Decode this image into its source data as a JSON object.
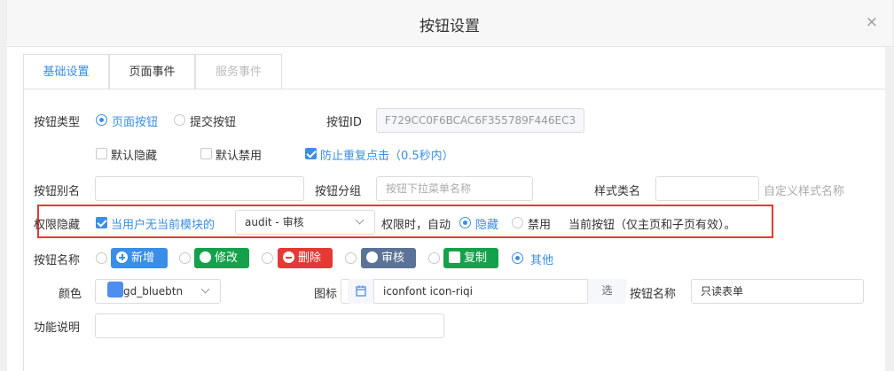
{
  "dialog": {
    "title": "按钮设置",
    "close_glyph": "×"
  },
  "tabs": [
    {
      "label": "基础设置",
      "state": "active"
    },
    {
      "label": "页面事件",
      "state": "normal"
    },
    {
      "label": "服务事件",
      "state": "disabled"
    }
  ],
  "button_type": {
    "label": "按钮类型",
    "options": [
      {
        "label": "页面按钮",
        "selected": true
      },
      {
        "label": "提交按钮",
        "selected": false
      }
    ]
  },
  "button_id": {
    "label": "按钮ID",
    "value": "F729CC0F6BCAC6F355789F446EC3"
  },
  "flags": [
    {
      "label": "默认隐藏",
      "checked": false
    },
    {
      "label": "默认禁用",
      "checked": false
    },
    {
      "label": "防止重复点击（0.5秒内）",
      "checked": true
    }
  ],
  "alias": {
    "label": "按钮别名",
    "value": ""
  },
  "group": {
    "label": "按钮分组",
    "placeholder": "按钮下拉菜单名称"
  },
  "style_class": {
    "label": "样式类名",
    "value": "",
    "hint": "自定义样式名称"
  },
  "permission": {
    "label": "权限隐藏",
    "check_label": "当用户无当前模块的",
    "checked": true,
    "module_value": "audit - 审核",
    "when_label": "权限时，自动",
    "actions": [
      {
        "label": "隐藏",
        "selected": true
      },
      {
        "label": "禁用",
        "selected": false
      }
    ],
    "scope_note": "当前按钮（仅主页和子页有效）。"
  },
  "button_name_presets": {
    "label": "按钮名称",
    "options": [
      {
        "label": "新增",
        "icon": "plus-circle-icon",
        "color": "#3a8ee6",
        "selected": false
      },
      {
        "label": "修改",
        "icon": "edit-icon",
        "color": "#15a14b",
        "selected": false
      },
      {
        "label": "删除",
        "icon": "minus-circle-icon",
        "color": "#e53935",
        "selected": false
      },
      {
        "label": "审核",
        "icon": "user-icon",
        "color": "#5b7397",
        "selected": false
      },
      {
        "label": "复制",
        "icon": "copy-icon",
        "color": "#15a14b",
        "selected": false
      },
      {
        "label": "其他",
        "selected": true
      }
    ]
  },
  "color": {
    "label": "颜色",
    "value": "gd_bluebtn",
    "swatch": "#4d8ef0"
  },
  "icon": {
    "label": "图标",
    "value": "iconfont icon-riqi",
    "pick_label": "选"
  },
  "button_name": {
    "label": "按钮名称",
    "value": "只读表单"
  },
  "description": {
    "label": "功能说明",
    "value": ""
  }
}
